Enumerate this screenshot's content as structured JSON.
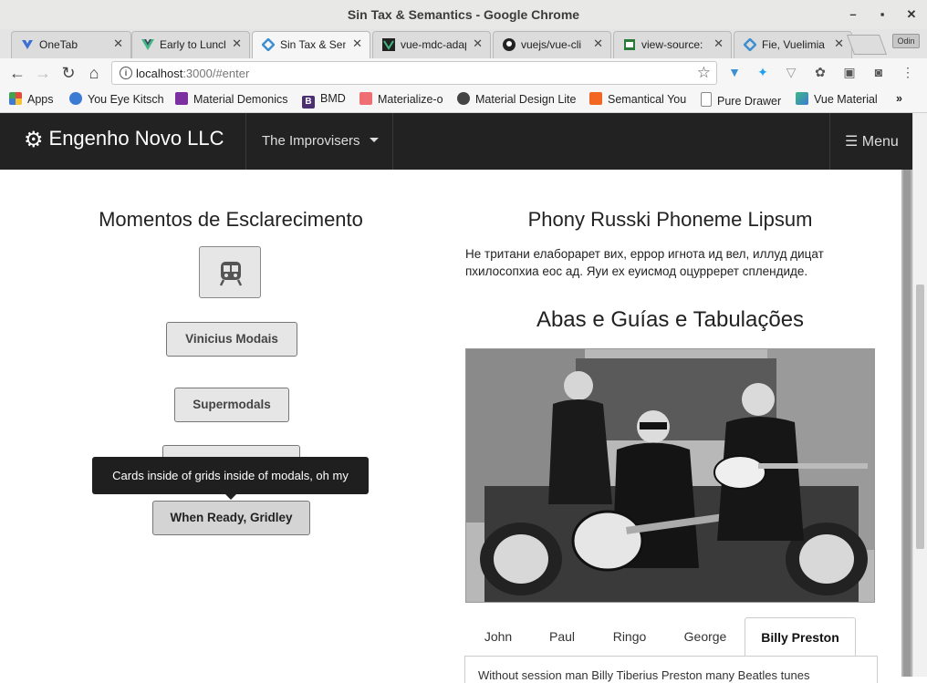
{
  "window": {
    "title": "Sin Tax & Semantics - Google Chrome"
  },
  "tabs": [
    {
      "label": "OneTab",
      "icon": "onetab-icon",
      "color": "#3b6fd4"
    },
    {
      "label": "Early to Lunch",
      "icon": "vue-icon",
      "color": "#41b883"
    },
    {
      "label": "Sin Tax & Semantics",
      "icon": "vue-icon",
      "color": "#3d8fd1",
      "active": true
    },
    {
      "label": "vue-mdc-adapter",
      "icon": "vue-icon",
      "color": "#222222"
    },
    {
      "label": "vuejs/vue-cli",
      "icon": "github-icon",
      "color": "#222222"
    },
    {
      "label": "view-source:",
      "icon": "page-icon",
      "color": "#2a7a3a"
    },
    {
      "label": "Fie, Vuelimia",
      "icon": "vue-icon",
      "color": "#3d8fd1"
    }
  ],
  "profile_label": "Odin",
  "address": {
    "host": "localhost",
    "rest": ":3000/#enter"
  },
  "bookmarks": [
    {
      "label": "Apps",
      "color": "#e24b3b"
    },
    {
      "label": "You Eye Kitsch",
      "color": "#3b7bd4"
    },
    {
      "label": "Material Demonics",
      "color": "#7b2fa0"
    },
    {
      "label": "BMD",
      "color": "#4b2f70"
    },
    {
      "label": "Materialize-o",
      "color": "#ee6e73"
    },
    {
      "label": "Material Design Lite",
      "color": "#444444"
    },
    {
      "label": "Semantical You",
      "color": "#f26522"
    },
    {
      "label": "Pure Drawer",
      "color": "#888888"
    },
    {
      "label": "Vue Material",
      "color": "#41b883"
    }
  ],
  "navbar": {
    "brand": "Engenho Novo LLC",
    "dropdown": "The Improvisers",
    "menu": "Menu"
  },
  "left": {
    "heading": "Momentos de Esclarecimento",
    "buttons": [
      "Vinicius Modais",
      "Supermodals",
      "When Ready, Gridley"
    ],
    "tooltip": "Cards inside of grids inside of modals, oh my"
  },
  "right": {
    "heading1": "Phony Russki Phoneme Lipsum",
    "paragraph": "Не тритани елаборарет вих, еррор игнота ид вел, иллуд дицат пхилосопхиа еос ад. Яуи ех еуисмод оцурререт сплендиде.",
    "heading2": "Abas e Guías e Tabulações",
    "tabs": [
      "John",
      "Paul",
      "Ringo",
      "George",
      "Billy Preston"
    ],
    "active_tab": "Billy Preston",
    "panel_text": "Without session man Billy Tiberius Preston many Beatles tunes"
  }
}
